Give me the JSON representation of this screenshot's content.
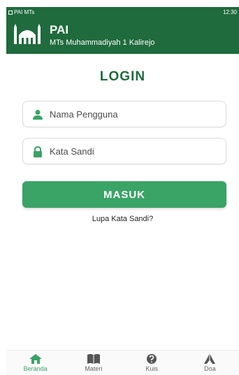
{
  "status_bar": {
    "app_label": "PAI MTs",
    "time": "12:30"
  },
  "header": {
    "title": "PAI",
    "subtitle": "MTs Muhammadiyah 1 Kalirejo",
    "icon": "mosque-icon"
  },
  "login": {
    "title": "LOGIN",
    "username_placeholder": "Nama Pengguna",
    "password_placeholder": "Kata Sandi",
    "submit_label": "MASUK",
    "forgot_label": "Lupa Kata Sandi?"
  },
  "bottom_nav": {
    "items": [
      {
        "label": "Beranda",
        "icon": "home-icon",
        "active": true
      },
      {
        "label": "Materi",
        "icon": "book-icon",
        "active": false
      },
      {
        "label": "Kuis",
        "icon": "question-icon",
        "active": false
      },
      {
        "label": "Doa",
        "icon": "praying-hands-icon",
        "active": false
      }
    ]
  },
  "colors": {
    "header": "#1f6b3d",
    "accent": "#3aa366",
    "title": "#1f6b3d"
  }
}
